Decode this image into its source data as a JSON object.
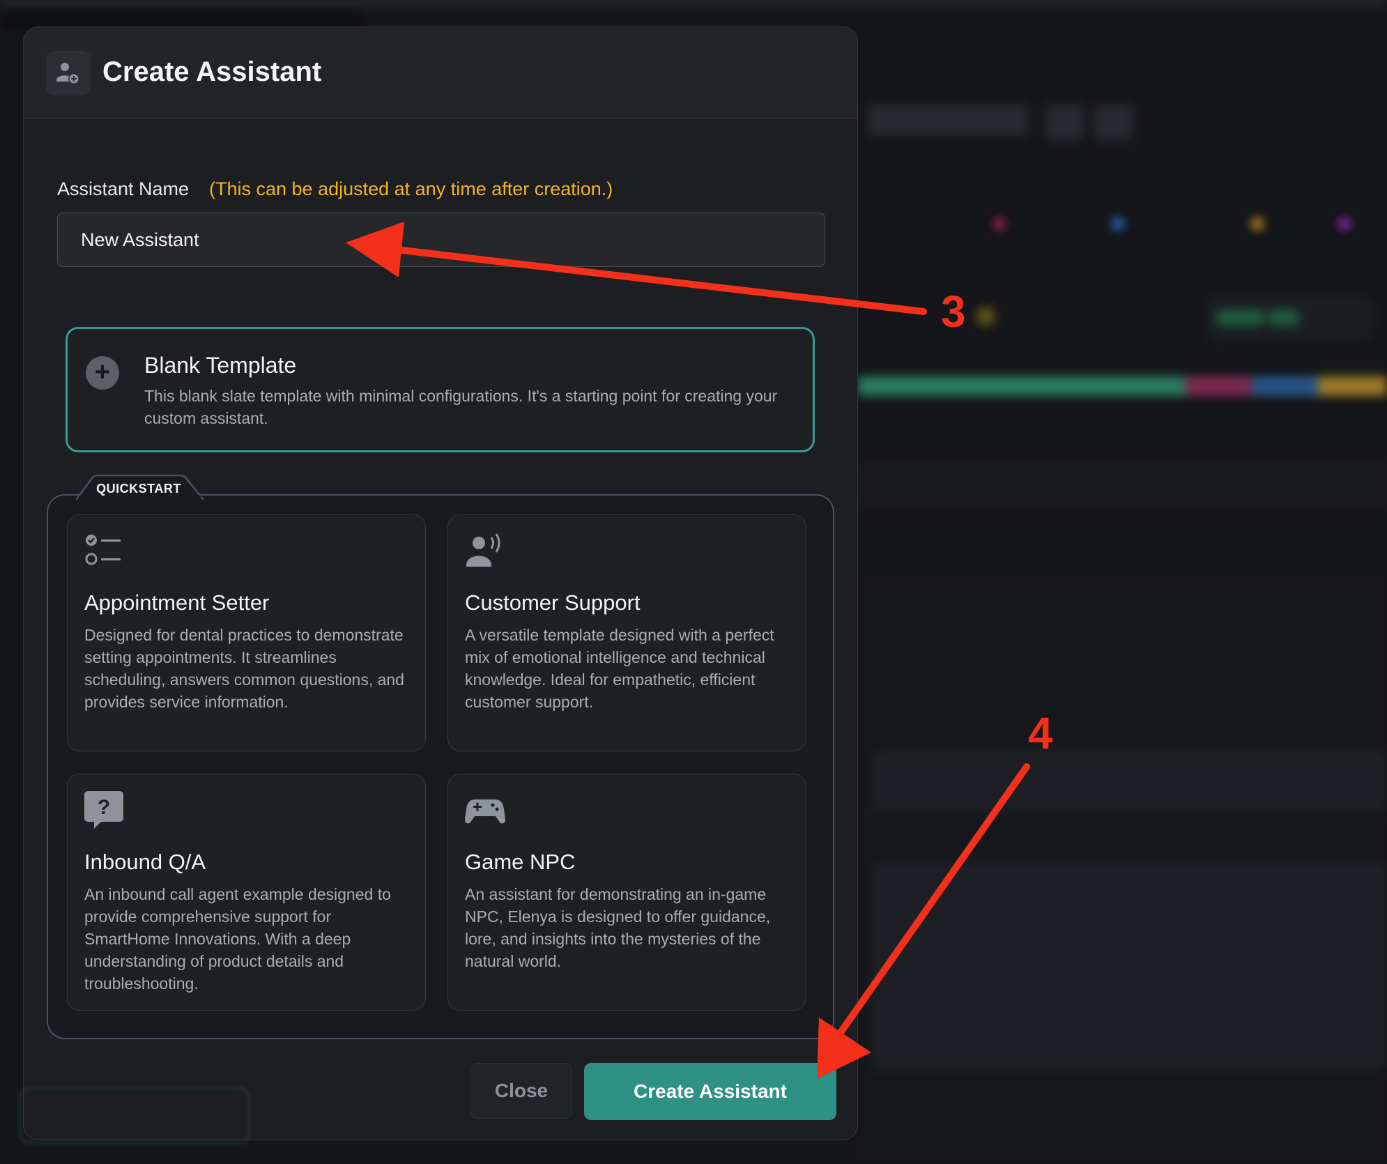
{
  "modal": {
    "title": "Create Assistant",
    "title_icon": "user-plus-icon"
  },
  "name_field": {
    "label": "Assistant Name",
    "hint": "(This can be adjusted at any time after creation.)",
    "value": "New Assistant"
  },
  "blank_template": {
    "icon": "plus-circle-icon",
    "title": "Blank Template",
    "description": "This blank slate template with minimal configurations. It's a starting point for creating your custom assistant."
  },
  "quickstart": {
    "label": "QUICKSTART",
    "cards": [
      {
        "icon": "checklist-icon",
        "title": "Appointment Setter",
        "description": "Designed for dental practices to demonstrate setting appointments. It streamlines scheduling, answers common questions, and provides service information."
      },
      {
        "icon": "speaking-person-icon",
        "title": "Customer Support",
        "description": "A versatile template designed with a perfect mix of emotional intelligence and technical knowledge. Ideal for empathetic, efficient customer support."
      },
      {
        "icon": "question-bubble-icon",
        "title": "Inbound Q/A",
        "description": "An inbound call agent example designed to provide comprehensive support for SmartHome Innovations. With a deep understanding of product details and troubleshooting."
      },
      {
        "icon": "gamepad-icon",
        "title": "Game NPC",
        "description": "An assistant for demonstrating an in-game NPC, Elenya is designed to offer guidance, lore, and insights into the mysteries of the natural world."
      }
    ]
  },
  "footer": {
    "close_label": "Close",
    "create_label": "Create Assistant"
  },
  "annotations": {
    "step_3": "3",
    "step_4": "4"
  },
  "colors": {
    "accent_teal": "#2f9085",
    "hint_yellow": "#f0b429",
    "annotation_red": "#f4301a"
  }
}
